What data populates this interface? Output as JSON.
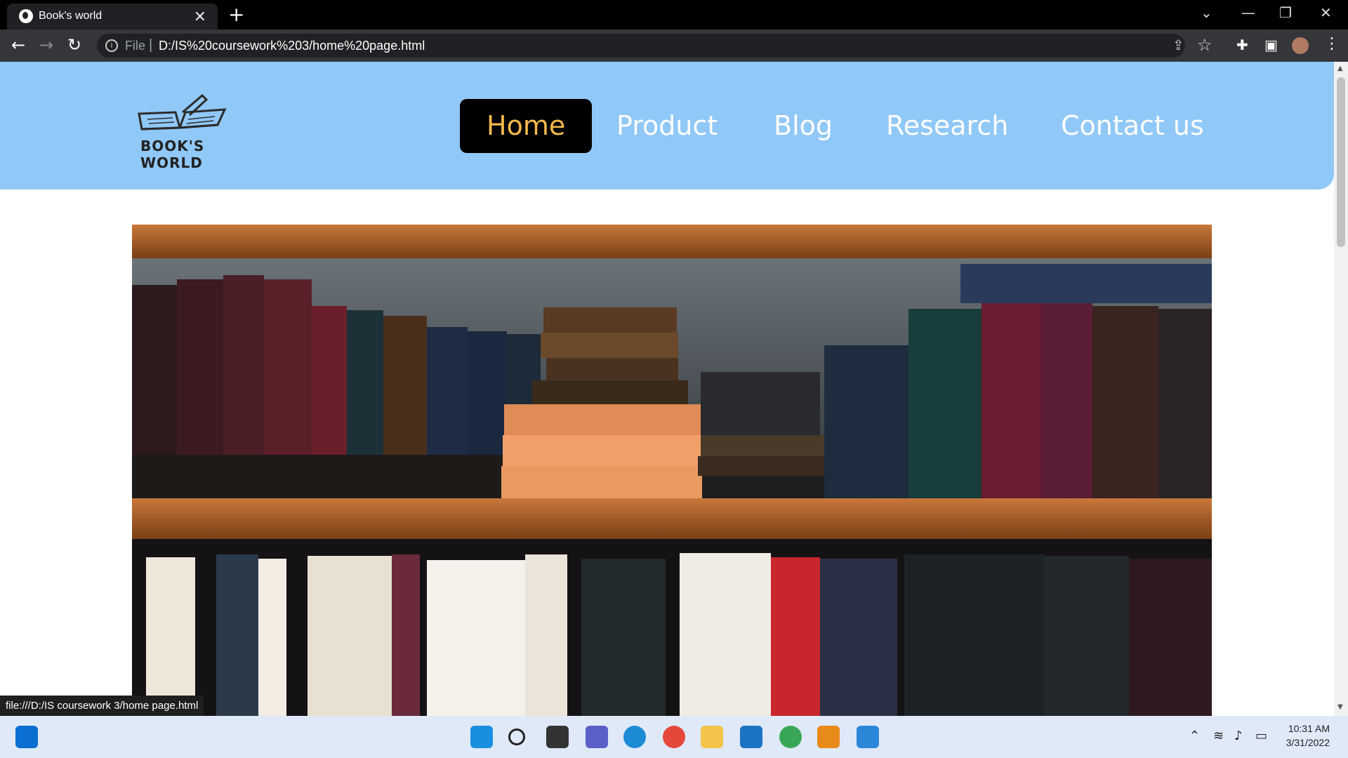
{
  "browser": {
    "tab_title": "Book's world",
    "tab_close": "×",
    "new_tab": "+",
    "scheme_label": "File",
    "url": "D:/IS%20coursework%203/home%20page.html",
    "status_url": "file:///D:/IS coursework 3/home page.html",
    "icons": [
      "globe-icon",
      "back-icon",
      "forward-icon",
      "reload-icon",
      "info-icon",
      "share-icon",
      "star-icon",
      "extensions-icon",
      "side-panel-icon",
      "profile-avatar",
      "menu-icon"
    ]
  },
  "site": {
    "logo_text": "BOOK'S WORLD",
    "nav": [
      {
        "label": "Home",
        "active": true
      },
      {
        "label": "Product",
        "active": false
      },
      {
        "label": "Blog",
        "active": false
      },
      {
        "label": "Research",
        "active": false
      },
      {
        "label": "Contact us",
        "active": false
      }
    ],
    "header_color": "#90c8f8",
    "active_text_color": "#f5b94a"
  },
  "taskbar": {
    "time": "10:31 AM",
    "date": "3/31/2022",
    "icons": [
      "windows-start-icon",
      "search-icon",
      "task-view-icon",
      "teams-chat-icon",
      "edge-icon",
      "chrome-icon",
      "file-explorer-icon",
      "mail-icon",
      "chrome-profile-icon",
      "sublime-text-icon",
      "photos-icon"
    ]
  }
}
